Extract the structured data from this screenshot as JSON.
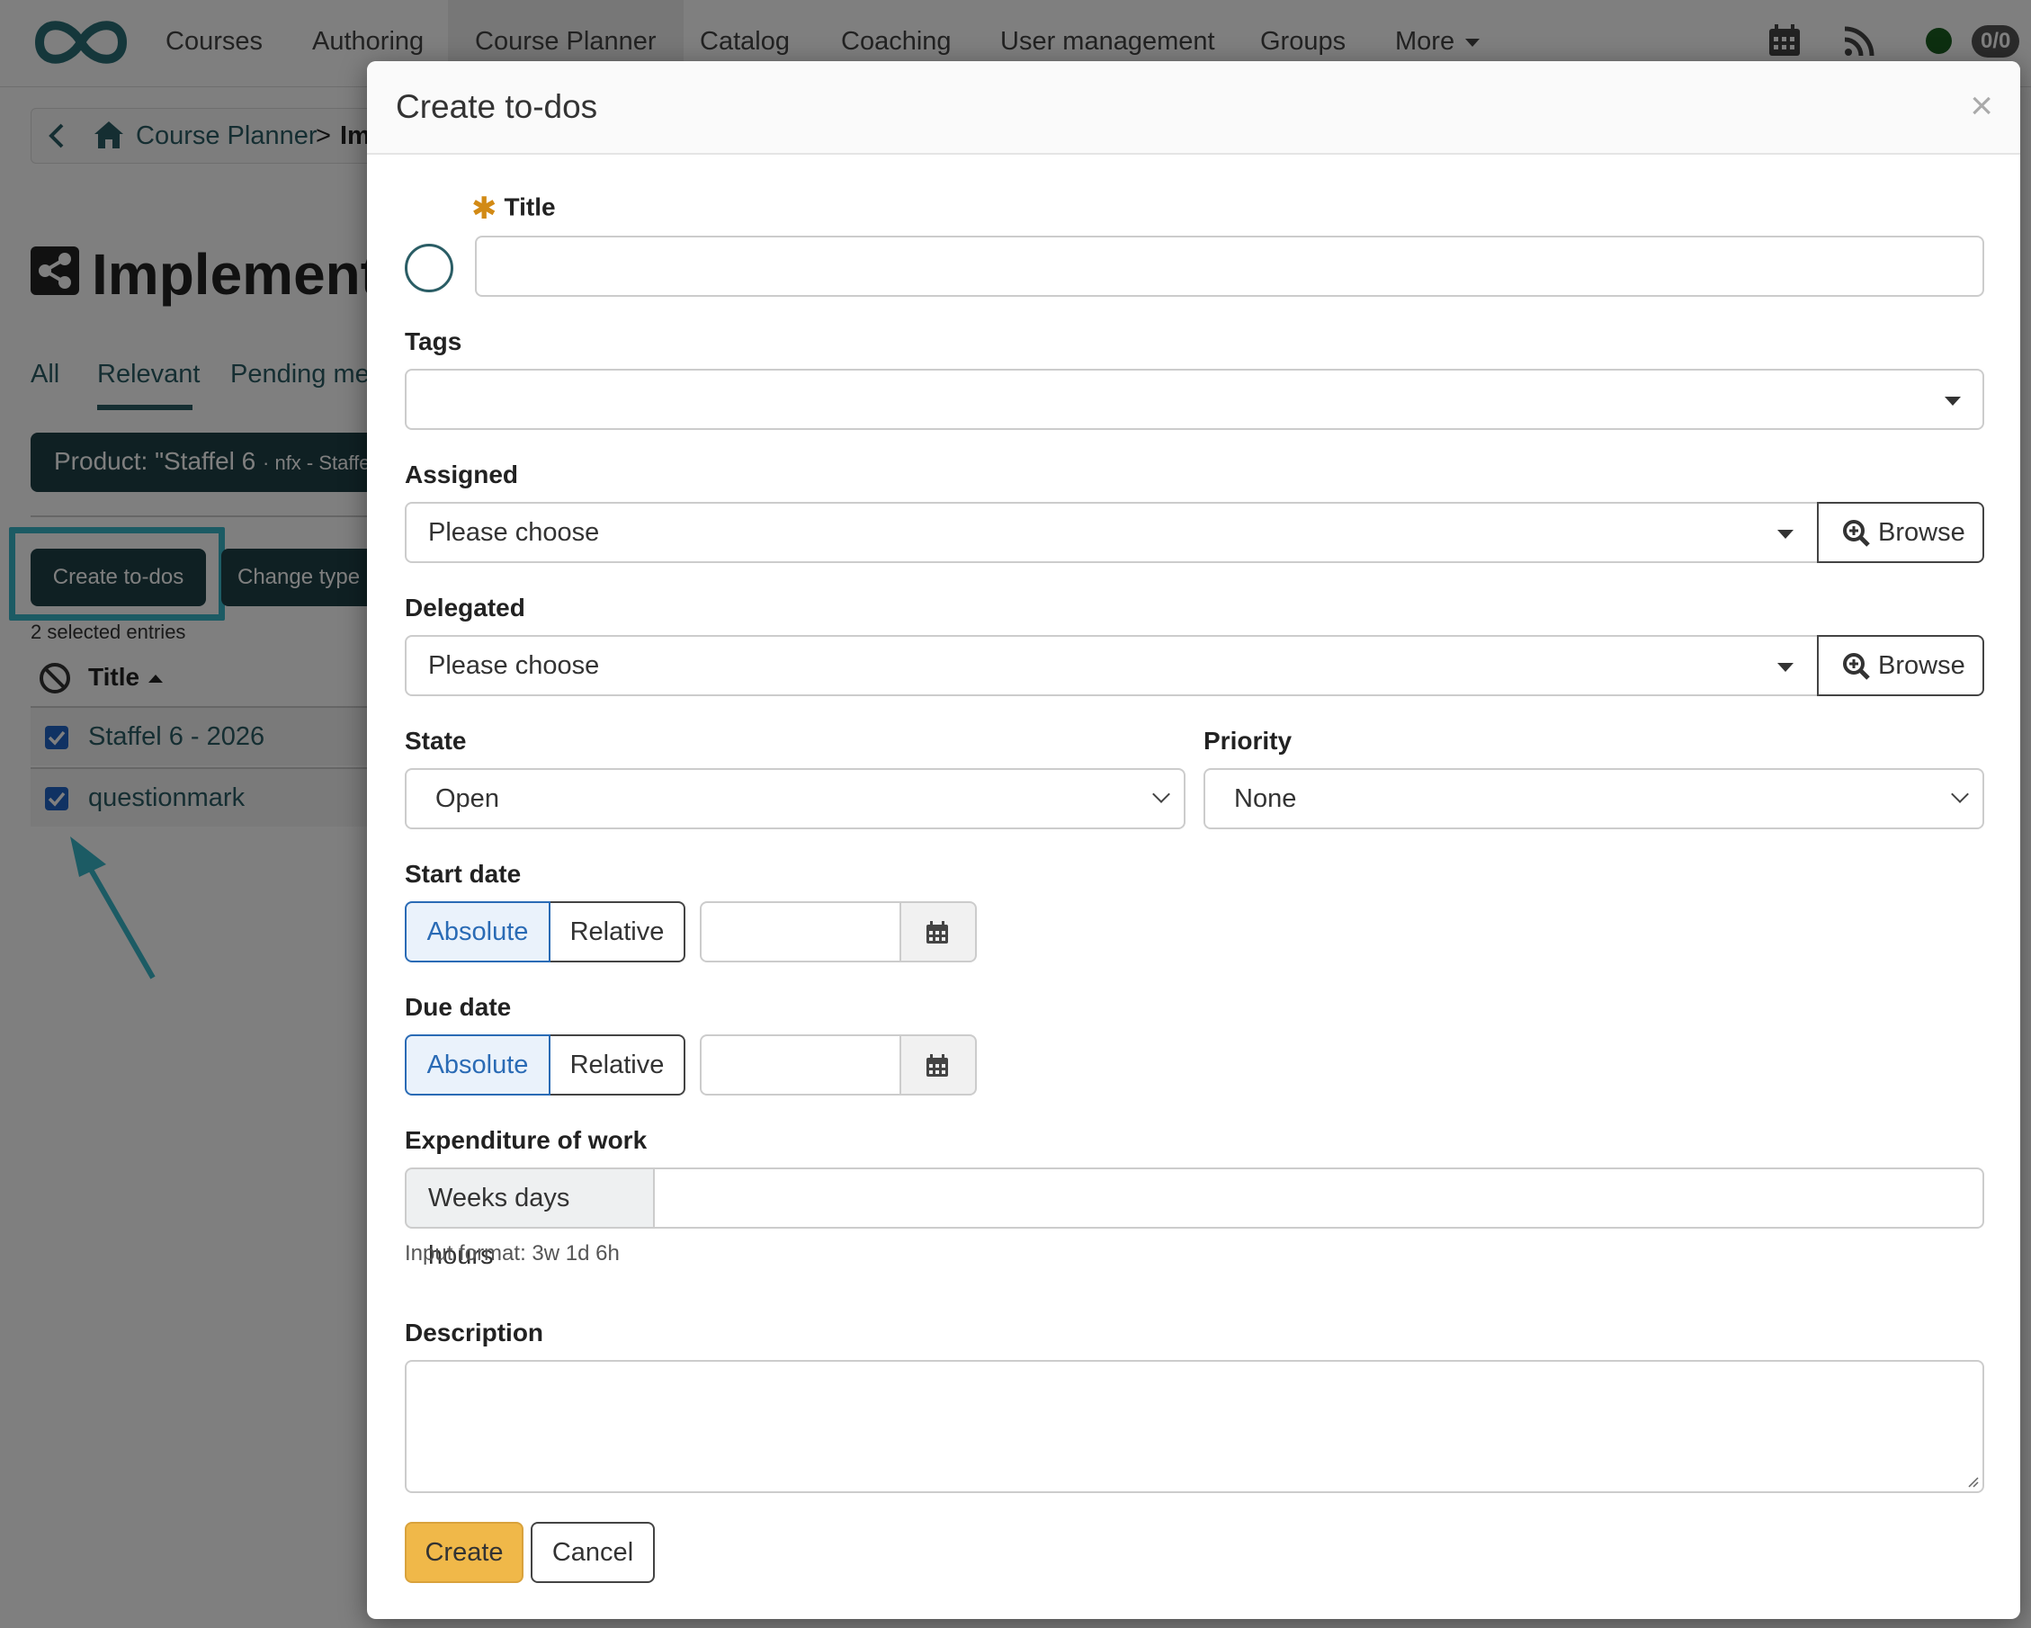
{
  "topnav": {
    "items": [
      "Courses",
      "Authoring",
      "Course Planner",
      "Catalog",
      "Coaching",
      "User management",
      "Groups",
      "More"
    ],
    "active_index": 2,
    "counter": "0/0"
  },
  "breadcrumb": {
    "root": "Course Planner",
    "separator": ">",
    "current": "Im"
  },
  "page": {
    "title": "Implementa"
  },
  "tabs": [
    "All",
    "Relevant",
    "Pending mer"
  ],
  "filter": {
    "label": "Product:",
    "value": "\"Staffel 6",
    "value_small": "· nfx - Staffe..."
  },
  "bulk_actions": {
    "create_todos": "Create to-dos",
    "change_type": "Change type",
    "selected_count": "2 selected entries"
  },
  "table": {
    "header_title": "Title",
    "rows": [
      "Staffel 6 - 2026",
      "questionmark"
    ]
  },
  "modal": {
    "title": "Create to-dos",
    "close_glyph": "×",
    "fields": {
      "title_label": "Title",
      "tags_label": "Tags",
      "assigned_label": "Assigned",
      "assigned_value": "Please choose",
      "delegated_label": "Delegated",
      "delegated_value": "Please choose",
      "browse_label": "Browse",
      "state_label": "State",
      "state_value": "Open",
      "priority_label": "Priority",
      "priority_value": "None",
      "start_date_label": "Start date",
      "due_date_label": "Due date",
      "absolute_label": "Absolute",
      "relative_label": "Relative",
      "expenditure_label": "Expenditure of work",
      "expenditure_addon": "Weeks days hours",
      "expenditure_help": "Input format: 3w 1d 6h",
      "description_label": "Description"
    },
    "buttons": {
      "create": "Create",
      "cancel": "Cancel"
    }
  },
  "colors": {
    "brand_dark": "#1f4046",
    "link": "#2a5d65",
    "highlight": "#38b6c8",
    "primary_button": "#f0b849",
    "required_star": "#d28a15",
    "segment_active": "#2a6bb5"
  }
}
